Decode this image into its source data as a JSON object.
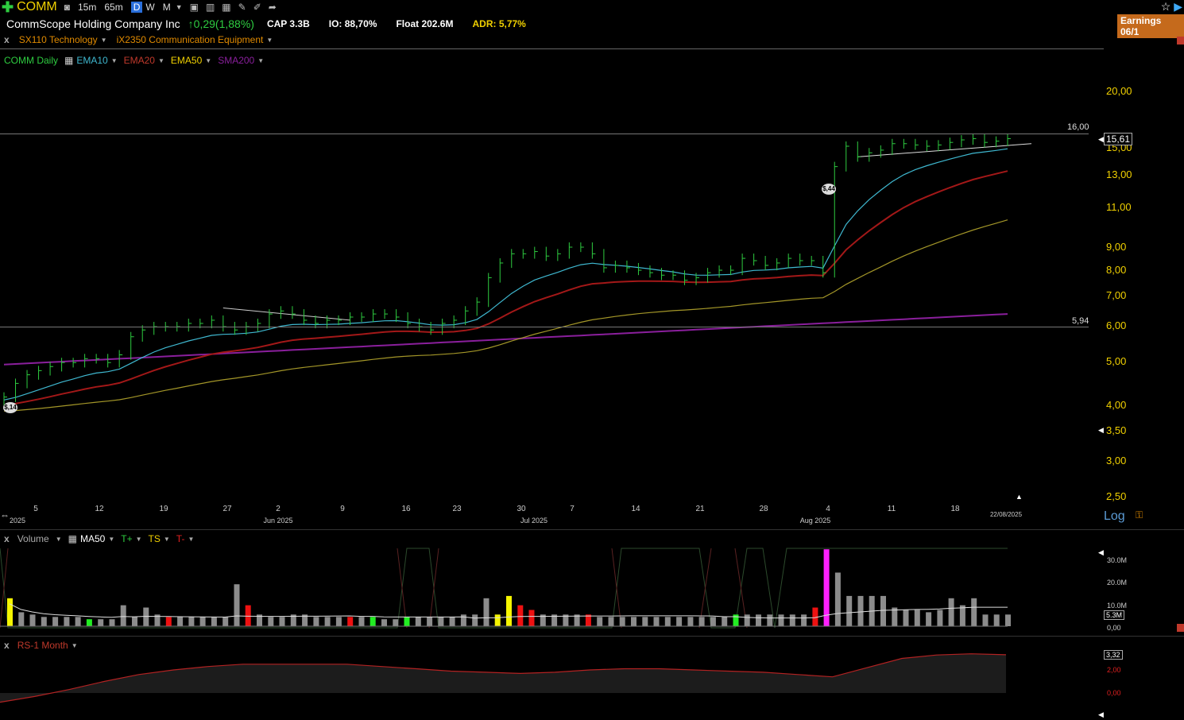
{
  "toolbar": {
    "ticker": "COMM",
    "timeframes": [
      "15m",
      "65m",
      "D",
      "W",
      "M"
    ],
    "active_timeframe": "D",
    "earnings_badge": "Earnings 06/1"
  },
  "info": {
    "company": "CommScope Holding Company Inc",
    "change": "0,29(1,88%)",
    "cap": "CAP 3.3B",
    "io": "IO: 88,70%",
    "float": "Float 202.6M",
    "adr": "ADR: 5,77%"
  },
  "sectors": {
    "close": "x",
    "sector": "SX110 Technology",
    "industry": "iX2350 Communication Equipment"
  },
  "legend": {
    "series": "COMM Daily",
    "ema10": "EMA10",
    "ema20": "EMA20",
    "ema50": "EMA50",
    "sma200": "SMA200"
  },
  "colors": {
    "up": "#2ecc40",
    "ema10": "#3fb8d0",
    "ema20": "#a31818",
    "ema50": "#a39628",
    "sma200": "#8a1f9c",
    "volume_gray": "#8c8c8c",
    "earnings": "#c56a1c"
  },
  "price_axis": {
    "labels": [
      "20,00",
      "15,00",
      "13,00",
      "11,00",
      "9,00",
      "8,00",
      "7,00",
      "6,00",
      "5,00",
      "4,00",
      "3,50",
      "3,00",
      "2,50"
    ],
    "last_price": "15,61",
    "level_high": "16,00",
    "level_low": "5,94",
    "scale": "Log"
  },
  "date_axis": {
    "days": [
      "5",
      "12",
      "19",
      "27",
      "2",
      "9",
      "16",
      "23",
      "30",
      "7",
      "14",
      "21",
      "28",
      "4",
      "11",
      "18"
    ],
    "months": [
      "2025",
      "Jun 2025",
      "Jul 2025",
      "Aug 2025"
    ],
    "end_date": "22/08/2025"
  },
  "annotations": {
    "low_badge": "$,14",
    "gap_badge": "$,44"
  },
  "volume_panel": {
    "title": "Volume",
    "ma": "MA50",
    "tplus": "T+",
    "ts": "TS",
    "tminus": "T-",
    "axis": [
      "30.0M",
      "20.0M",
      "10.0M",
      "0,00"
    ],
    "current": "5.3M"
  },
  "rs_panel": {
    "title": "RS-1 Month",
    "axis": [
      "2,00",
      "0,00"
    ],
    "current": "3,32"
  },
  "chart_data": {
    "type": "line",
    "series_kind": "ohlc-daily",
    "scale": "log",
    "ylim": [
      2.5,
      20
    ],
    "closes": [
      4.1,
      4.4,
      4.6,
      4.7,
      4.8,
      4.9,
      4.9,
      5.0,
      5.0,
      4.9,
      5.1,
      5.6,
      5.8,
      5.9,
      5.9,
      5.9,
      6.0,
      6.0,
      6.1,
      5.9,
      5.8,
      5.9,
      6.0,
      6.3,
      6.4,
      6.3,
      6.1,
      6.0,
      6.1,
      6.1,
      6.2,
      6.2,
      6.3,
      6.3,
      6.2,
      6.0,
      5.9,
      5.8,
      6.0,
      6.1,
      6.4,
      6.7,
      7.6,
      8.2,
      8.6,
      8.6,
      8.7,
      8.5,
      8.6,
      8.9,
      8.9,
      8.6,
      8.0,
      8.1,
      8.0,
      7.9,
      7.8,
      7.7,
      7.7,
      7.5,
      7.6,
      7.8,
      7.9,
      7.9,
      8.4,
      8.3,
      8.1,
      8.2,
      8.4,
      8.3,
      8.3,
      7.8,
      13.5,
      15.0,
      14.2,
      14.5,
      14.7,
      15.2,
      15.2,
      15.1,
      15.0,
      15.1,
      15.3,
      15.5,
      15.6,
      15.3,
      15.4,
      15.6
    ],
    "ema10_end": 15.1,
    "ema20_end": 13.9,
    "ema50_end": 10.9,
    "sma200_end": 6.3,
    "volume_millions": [
      12,
      6,
      5,
      4,
      4,
      4,
      4,
      3,
      3,
      3,
      9,
      4,
      8,
      5,
      4,
      4,
      4,
      4,
      4,
      4,
      18,
      9,
      5,
      4,
      4,
      5,
      5,
      4,
      4,
      4,
      4,
      4,
      4,
      3,
      3,
      4,
      4,
      4,
      4,
      4,
      5,
      5,
      12,
      5,
      13,
      9,
      7,
      5,
      5,
      5,
      5,
      5,
      4,
      4,
      4,
      4,
      4,
      4,
      4,
      4,
      4,
      4,
      4,
      4,
      5,
      5,
      5,
      5,
      5,
      5,
      5,
      8,
      33,
      23,
      13,
      13,
      13,
      13,
      8,
      7,
      7,
      6,
      7,
      12,
      9,
      12,
      5,
      5,
      5
    ],
    "rs_values": [
      -0.8,
      -0.3,
      0.3,
      1.0,
      1.6,
      2.0,
      2.3,
      2.5,
      2.5,
      2.5,
      2.5,
      2.3,
      2.1,
      1.9,
      1.8,
      1.7,
      1.8,
      2.0,
      2.1,
      2.1,
      2.0,
      1.9,
      1.8,
      1.6,
      1.4,
      2.2,
      3.0,
      3.3,
      3.4,
      3.32
    ]
  }
}
